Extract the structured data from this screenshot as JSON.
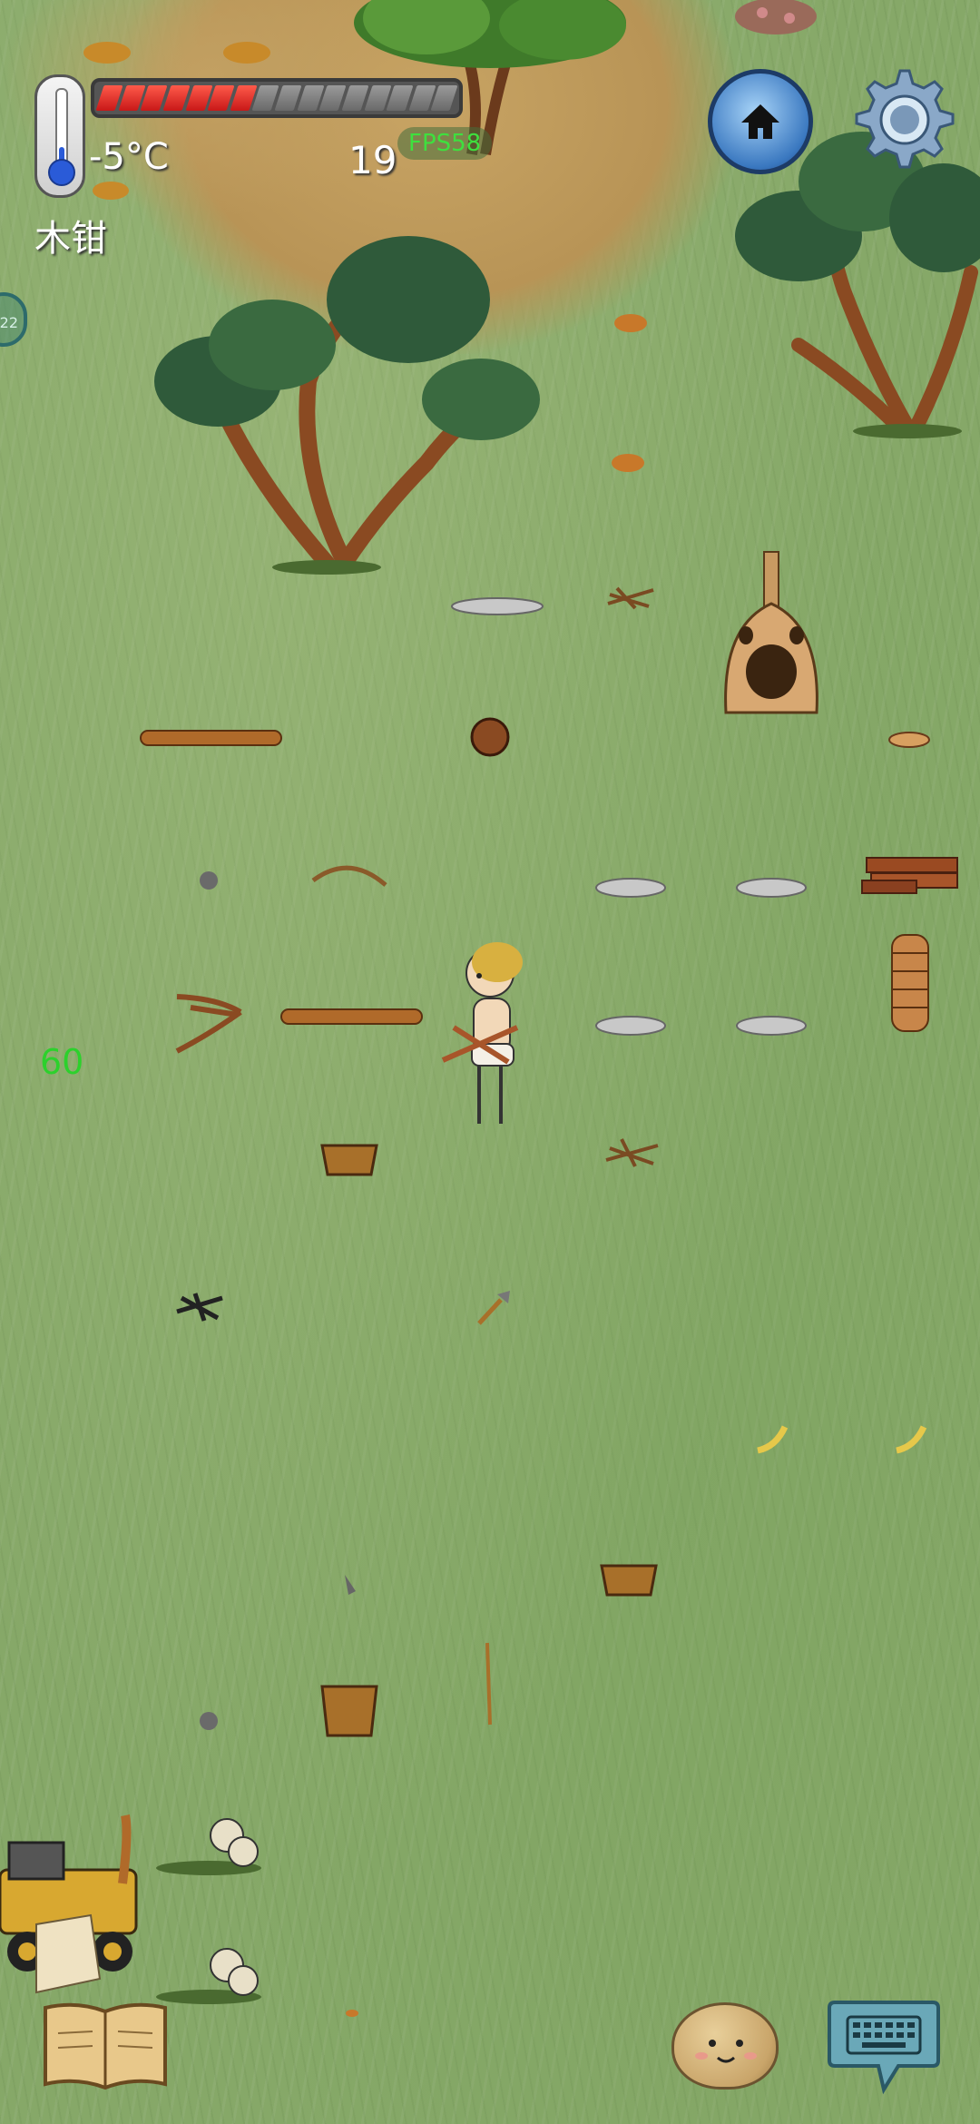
{
  "hud": {
    "temperature": "-5°C",
    "held_item": "木钳",
    "age": "19",
    "fps_badge": "FPS58",
    "fps_side": "60",
    "side_tab_label": "22",
    "food_bar": {
      "filled": 7,
      "total": 16
    },
    "temperature_level": 0.25
  },
  "buttons": {
    "home_icon": "home-icon",
    "settings_icon": "gear-icon",
    "recipe_book_icon": "book-icon",
    "emote_icon": "face-icon",
    "chat_icon": "keyboard-icon"
  },
  "colors": {
    "grass": "#86a868",
    "dirt": "#c2a062",
    "food_full": "#e23a2a",
    "food_empty": "#8a8a8a",
    "fps_green": "#3ee03e",
    "home_blue": "#3a78c0"
  }
}
